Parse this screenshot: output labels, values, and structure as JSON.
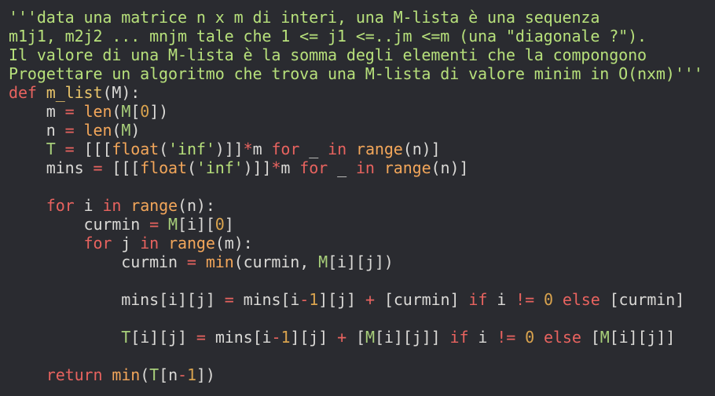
{
  "editor": {
    "language": "python",
    "colors": {
      "background": "#2a2b30",
      "docstring": "#b7e07b",
      "keyword": "#e8635f",
      "function_name": "#e9c46a",
      "builtin": "#f2a65a",
      "identifier": "#dad9d6",
      "number": "#d9a34e",
      "string": "#b7e07b",
      "accent_identifier": "#a8cf7a"
    },
    "lines": [
      [
        {
          "t": "doc",
          "v": "'''data una matrice n x m di interi, una M-lista è una sequenza"
        }
      ],
      [
        {
          "t": "doc",
          "v": "m1j1, m2j2 ... mnjm tale che 1 <= j1 <=..jm <=m (una \"diagonale ?\")."
        }
      ],
      [
        {
          "t": "doc",
          "v": "Il valore di una M-lista è la somma degli elementi che la compongono"
        }
      ],
      [
        {
          "t": "doc",
          "v": "Progettare un algoritmo che trova una M-lista di valore minim in O(nxm)'''"
        }
      ],
      [
        {
          "t": "kw",
          "v": "def"
        },
        {
          "t": "sp",
          "v": " "
        },
        {
          "t": "fn",
          "v": "m_list"
        },
        {
          "t": "pun",
          "v": "("
        },
        {
          "t": "id",
          "v": "M"
        },
        {
          "t": "pun",
          "v": "):"
        }
      ],
      [
        {
          "t": "sp",
          "v": "    "
        },
        {
          "t": "id",
          "v": "m"
        },
        {
          "t": "sp",
          "v": " "
        },
        {
          "t": "op",
          "v": "="
        },
        {
          "t": "sp",
          "v": " "
        },
        {
          "t": "bi",
          "v": "len"
        },
        {
          "t": "pun",
          "v": "("
        },
        {
          "t": "alt",
          "v": "M"
        },
        {
          "t": "pun",
          "v": "["
        },
        {
          "t": "num",
          "v": "0"
        },
        {
          "t": "pun",
          "v": "])"
        }
      ],
      [
        {
          "t": "sp",
          "v": "    "
        },
        {
          "t": "id",
          "v": "n"
        },
        {
          "t": "sp",
          "v": " "
        },
        {
          "t": "op",
          "v": "="
        },
        {
          "t": "sp",
          "v": " "
        },
        {
          "t": "bi",
          "v": "len"
        },
        {
          "t": "pun",
          "v": "("
        },
        {
          "t": "alt",
          "v": "M"
        },
        {
          "t": "pun",
          "v": ")"
        }
      ],
      [
        {
          "t": "sp",
          "v": "    "
        },
        {
          "t": "alt",
          "v": "T"
        },
        {
          "t": "sp",
          "v": " "
        },
        {
          "t": "op",
          "v": "="
        },
        {
          "t": "sp",
          "v": " "
        },
        {
          "t": "pun",
          "v": "[[["
        },
        {
          "t": "bi",
          "v": "float"
        },
        {
          "t": "pun",
          "v": "("
        },
        {
          "t": "str",
          "v": "'inf'"
        },
        {
          "t": "pun",
          "v": ")]]"
        },
        {
          "t": "op",
          "v": "*"
        },
        {
          "t": "id",
          "v": "m"
        },
        {
          "t": "sp",
          "v": " "
        },
        {
          "t": "kw",
          "v": "for"
        },
        {
          "t": "sp",
          "v": " "
        },
        {
          "t": "id",
          "v": "_"
        },
        {
          "t": "sp",
          "v": " "
        },
        {
          "t": "kw",
          "v": "in"
        },
        {
          "t": "sp",
          "v": " "
        },
        {
          "t": "bi",
          "v": "range"
        },
        {
          "t": "pun",
          "v": "("
        },
        {
          "t": "id",
          "v": "n"
        },
        {
          "t": "pun",
          "v": ")]"
        }
      ],
      [
        {
          "t": "sp",
          "v": "    "
        },
        {
          "t": "id",
          "v": "mins"
        },
        {
          "t": "sp",
          "v": " "
        },
        {
          "t": "op",
          "v": "="
        },
        {
          "t": "sp",
          "v": " "
        },
        {
          "t": "pun",
          "v": "[[["
        },
        {
          "t": "bi",
          "v": "float"
        },
        {
          "t": "pun",
          "v": "("
        },
        {
          "t": "str",
          "v": "'inf'"
        },
        {
          "t": "pun",
          "v": ")]]"
        },
        {
          "t": "op",
          "v": "*"
        },
        {
          "t": "id",
          "v": "m"
        },
        {
          "t": "sp",
          "v": " "
        },
        {
          "t": "kw",
          "v": "for"
        },
        {
          "t": "sp",
          "v": " "
        },
        {
          "t": "id",
          "v": "_"
        },
        {
          "t": "sp",
          "v": " "
        },
        {
          "t": "kw",
          "v": "in"
        },
        {
          "t": "sp",
          "v": " "
        },
        {
          "t": "bi",
          "v": "range"
        },
        {
          "t": "pun",
          "v": "("
        },
        {
          "t": "id",
          "v": "n"
        },
        {
          "t": "pun",
          "v": ")]"
        }
      ],
      [],
      [
        {
          "t": "sp",
          "v": "    "
        },
        {
          "t": "kw",
          "v": "for"
        },
        {
          "t": "sp",
          "v": " "
        },
        {
          "t": "id",
          "v": "i"
        },
        {
          "t": "sp",
          "v": " "
        },
        {
          "t": "kw",
          "v": "in"
        },
        {
          "t": "sp",
          "v": " "
        },
        {
          "t": "bi",
          "v": "range"
        },
        {
          "t": "pun",
          "v": "("
        },
        {
          "t": "id",
          "v": "n"
        },
        {
          "t": "pun",
          "v": "):"
        }
      ],
      [
        {
          "t": "sp",
          "v": "        "
        },
        {
          "t": "id",
          "v": "curmin"
        },
        {
          "t": "sp",
          "v": " "
        },
        {
          "t": "op",
          "v": "="
        },
        {
          "t": "sp",
          "v": " "
        },
        {
          "t": "alt",
          "v": "M"
        },
        {
          "t": "pun",
          "v": "["
        },
        {
          "t": "id",
          "v": "i"
        },
        {
          "t": "pun",
          "v": "]["
        },
        {
          "t": "num",
          "v": "0"
        },
        {
          "t": "pun",
          "v": "]"
        }
      ],
      [
        {
          "t": "sp",
          "v": "        "
        },
        {
          "t": "kw",
          "v": "for"
        },
        {
          "t": "sp",
          "v": " "
        },
        {
          "t": "id",
          "v": "j"
        },
        {
          "t": "sp",
          "v": " "
        },
        {
          "t": "kw",
          "v": "in"
        },
        {
          "t": "sp",
          "v": " "
        },
        {
          "t": "bi",
          "v": "range"
        },
        {
          "t": "pun",
          "v": "("
        },
        {
          "t": "id",
          "v": "m"
        },
        {
          "t": "pun",
          "v": "):"
        }
      ],
      [
        {
          "t": "sp",
          "v": "            "
        },
        {
          "t": "id",
          "v": "curmin"
        },
        {
          "t": "sp",
          "v": " "
        },
        {
          "t": "op",
          "v": "="
        },
        {
          "t": "sp",
          "v": " "
        },
        {
          "t": "bi",
          "v": "min"
        },
        {
          "t": "pun",
          "v": "("
        },
        {
          "t": "id",
          "v": "curmin"
        },
        {
          "t": "pun",
          "v": ", "
        },
        {
          "t": "alt",
          "v": "M"
        },
        {
          "t": "pun",
          "v": "["
        },
        {
          "t": "id",
          "v": "i"
        },
        {
          "t": "pun",
          "v": "]["
        },
        {
          "t": "id",
          "v": "j"
        },
        {
          "t": "pun",
          "v": "])"
        }
      ],
      [],
      [
        {
          "t": "sp",
          "v": "            "
        },
        {
          "t": "id",
          "v": "mins"
        },
        {
          "t": "pun",
          "v": "["
        },
        {
          "t": "id",
          "v": "i"
        },
        {
          "t": "pun",
          "v": "]["
        },
        {
          "t": "id",
          "v": "j"
        },
        {
          "t": "pun",
          "v": "]"
        },
        {
          "t": "sp",
          "v": " "
        },
        {
          "t": "op",
          "v": "="
        },
        {
          "t": "sp",
          "v": " "
        },
        {
          "t": "id",
          "v": "mins"
        },
        {
          "t": "pun",
          "v": "["
        },
        {
          "t": "id",
          "v": "i"
        },
        {
          "t": "op",
          "v": "-"
        },
        {
          "t": "num",
          "v": "1"
        },
        {
          "t": "pun",
          "v": "]["
        },
        {
          "t": "id",
          "v": "j"
        },
        {
          "t": "pun",
          "v": "]"
        },
        {
          "t": "sp",
          "v": " "
        },
        {
          "t": "op",
          "v": "+"
        },
        {
          "t": "sp",
          "v": " "
        },
        {
          "t": "pun",
          "v": "["
        },
        {
          "t": "id",
          "v": "curmin"
        },
        {
          "t": "pun",
          "v": "]"
        },
        {
          "t": "sp",
          "v": " "
        },
        {
          "t": "kw",
          "v": "if"
        },
        {
          "t": "sp",
          "v": " "
        },
        {
          "t": "id",
          "v": "i"
        },
        {
          "t": "sp",
          "v": " "
        },
        {
          "t": "op",
          "v": "!="
        },
        {
          "t": "sp",
          "v": " "
        },
        {
          "t": "num",
          "v": "0"
        },
        {
          "t": "sp",
          "v": " "
        },
        {
          "t": "kw",
          "v": "else"
        },
        {
          "t": "sp",
          "v": " "
        },
        {
          "t": "pun",
          "v": "["
        },
        {
          "t": "id",
          "v": "curmin"
        },
        {
          "t": "pun",
          "v": "]"
        }
      ],
      [],
      [
        {
          "t": "sp",
          "v": "            "
        },
        {
          "t": "alt",
          "v": "T"
        },
        {
          "t": "pun",
          "v": "["
        },
        {
          "t": "id",
          "v": "i"
        },
        {
          "t": "pun",
          "v": "]["
        },
        {
          "t": "id",
          "v": "j"
        },
        {
          "t": "pun",
          "v": "]"
        },
        {
          "t": "sp",
          "v": " "
        },
        {
          "t": "op",
          "v": "="
        },
        {
          "t": "sp",
          "v": " "
        },
        {
          "t": "id",
          "v": "mins"
        },
        {
          "t": "pun",
          "v": "["
        },
        {
          "t": "id",
          "v": "i"
        },
        {
          "t": "op",
          "v": "-"
        },
        {
          "t": "num",
          "v": "1"
        },
        {
          "t": "pun",
          "v": "]["
        },
        {
          "t": "id",
          "v": "j"
        },
        {
          "t": "pun",
          "v": "]"
        },
        {
          "t": "sp",
          "v": " "
        },
        {
          "t": "op",
          "v": "+"
        },
        {
          "t": "sp",
          "v": " "
        },
        {
          "t": "pun",
          "v": "["
        },
        {
          "t": "alt",
          "v": "M"
        },
        {
          "t": "pun",
          "v": "["
        },
        {
          "t": "id",
          "v": "i"
        },
        {
          "t": "pun",
          "v": "]["
        },
        {
          "t": "id",
          "v": "j"
        },
        {
          "t": "pun",
          "v": "]]"
        },
        {
          "t": "sp",
          "v": " "
        },
        {
          "t": "kw",
          "v": "if"
        },
        {
          "t": "sp",
          "v": " "
        },
        {
          "t": "id",
          "v": "i"
        },
        {
          "t": "sp",
          "v": " "
        },
        {
          "t": "op",
          "v": "!="
        },
        {
          "t": "sp",
          "v": " "
        },
        {
          "t": "num",
          "v": "0"
        },
        {
          "t": "sp",
          "v": " "
        },
        {
          "t": "kw",
          "v": "else"
        },
        {
          "t": "sp",
          "v": " "
        },
        {
          "t": "pun",
          "v": "["
        },
        {
          "t": "alt",
          "v": "M"
        },
        {
          "t": "pun",
          "v": "["
        },
        {
          "t": "id",
          "v": "i"
        },
        {
          "t": "pun",
          "v": "]["
        },
        {
          "t": "id",
          "v": "j"
        },
        {
          "t": "pun",
          "v": "]]"
        }
      ],
      [],
      [
        {
          "t": "sp",
          "v": "    "
        },
        {
          "t": "kw",
          "v": "return"
        },
        {
          "t": "sp",
          "v": " "
        },
        {
          "t": "bi",
          "v": "min"
        },
        {
          "t": "pun",
          "v": "("
        },
        {
          "t": "alt",
          "v": "T"
        },
        {
          "t": "pun",
          "v": "["
        },
        {
          "t": "id",
          "v": "n"
        },
        {
          "t": "op",
          "v": "-"
        },
        {
          "t": "num",
          "v": "1"
        },
        {
          "t": "pun",
          "v": "])"
        }
      ]
    ]
  }
}
